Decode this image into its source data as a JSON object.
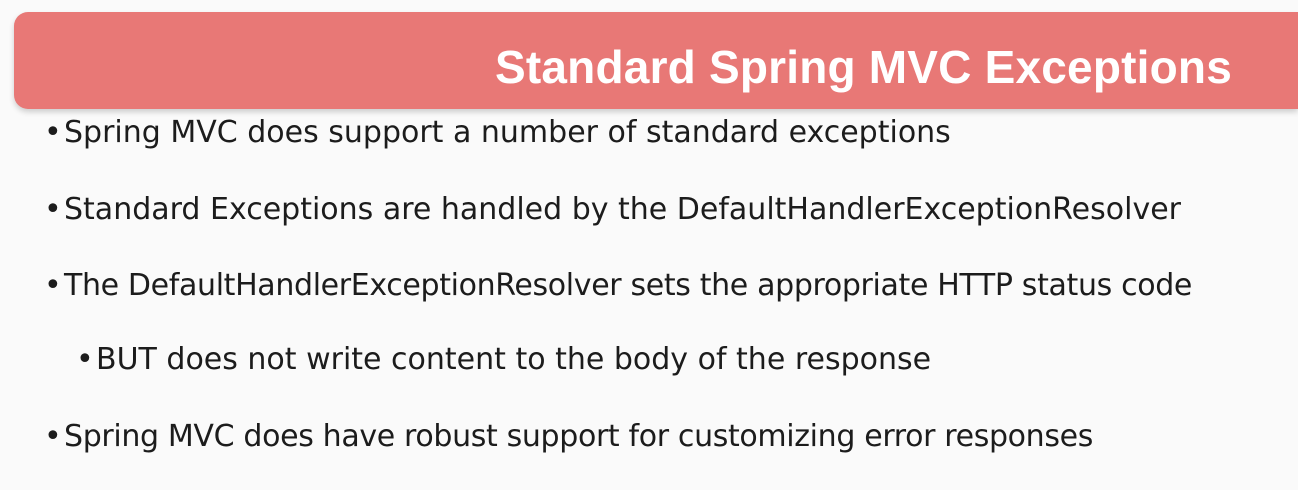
{
  "slide": {
    "title": "Standard Spring MVC Exceptions",
    "bullet_glyph": "•",
    "bullets": [
      {
        "text": "Spring MVC does support a number of standard exceptions",
        "level": 1
      },
      {
        "text": "Standard Exceptions are handled by the DefaultHandlerExceptionResolver",
        "level": 1
      },
      {
        "text": "The DefaultHandlerExceptionResolver sets the appropriate HTTP status code",
        "level": 1
      },
      {
        "text": "BUT does not write content to the body of the response",
        "level": 2
      },
      {
        "text": "Spring MVC does have robust support for customizing error responses",
        "level": 1
      }
    ]
  },
  "colors": {
    "title_bar": "#e87876",
    "title_text": "#ffffff",
    "body_text": "#1c1c1c",
    "background": "#fafafa"
  }
}
